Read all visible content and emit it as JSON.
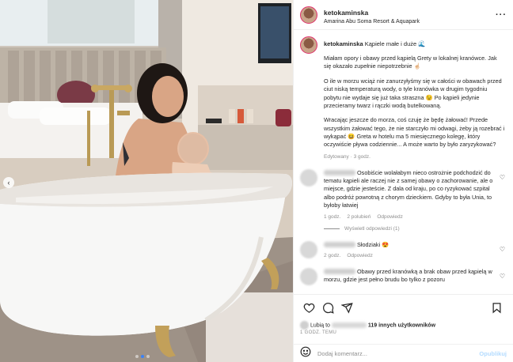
{
  "header": {
    "username": "ketokaminska",
    "location": "Amarina Abu Soma Resort & Aquapark",
    "more_icon": "more-horizontal-icon"
  },
  "caption": {
    "username": "ketokaminska",
    "title": "Kąpiele małe i duże 🌊",
    "paragraphs": [
      "Miałam opory i obawy przed kąpielą Grety w lokalnej kranówce. Jak się okazało zupełnie niepotrzebnie ☝🏻",
      "O ile w morzu wciąż nie zanurzyłyśmy się w całości w obawach przed ciut niską temperaturą wody, o tyle kranówka w drugim tygodniu pobytu nie wydaje się już taka straszna 😉 Po kąpieli jedynie przecieramy twarz i rączki wodą butelkowaną.",
      "Wracając jeszcze do morza, coś czuję że będę żałować! Przede wszystkim żałować tego, że nie starczyło mi odwagi, żeby ją rozebrać i wykąpać 😆 Greta w hotelu ma 5 miesięcznego kolegę, który oczywiście pływa codziennie... A może warto by było zaryzykować?"
    ],
    "meta": "Edytowany · 3 godz."
  },
  "comments": [
    {
      "text": "Osobiście wolałabym nieco ostrożnie podchodzić do tematu kąpieli ale raczej nie z samej obawy o zachorowanie, ale o miejsce, gdzie jesteście. Z dala od kraju, po co ryzykować szpital albo podróż powrotną z chorym dzieckiem. Gdyby to była Unia, to byłoby łatwiej",
      "time": "1 godz.",
      "likes": "2 polubień",
      "reply": "Odpowiedz",
      "view_replies": "Wyświetl odpowiedzi (1)"
    },
    {
      "text": "Słodziaki 😍",
      "time": "2 godz.",
      "likes": "",
      "reply": "Odpowiedz"
    },
    {
      "text": "Obawy przed kranówką a brak obaw przed kąpielą w morzu, gdzie jest pełno brudu bo tylko z pozoru",
      "time": "",
      "likes": "",
      "reply": ""
    }
  ],
  "likes": {
    "prefix": "Lubią to",
    "suffix": "119 innych użytkowników",
    "date": "1 GODZ. TEMU"
  },
  "add_comment": {
    "placeholder": "Dodaj komentarz...",
    "publish": "Opublikuj"
  },
  "icons": {
    "like": "heart-icon",
    "comment": "comment-icon",
    "share": "send-icon",
    "save": "bookmark-icon",
    "emoji": "emoji-icon",
    "nav": "chevron-left-icon"
  },
  "carousel": {
    "count": 3,
    "active_index": 1
  },
  "colors": {
    "accent": "#0095f6",
    "story_ring": "#e1306c",
    "muted": "#8e8e8e"
  }
}
